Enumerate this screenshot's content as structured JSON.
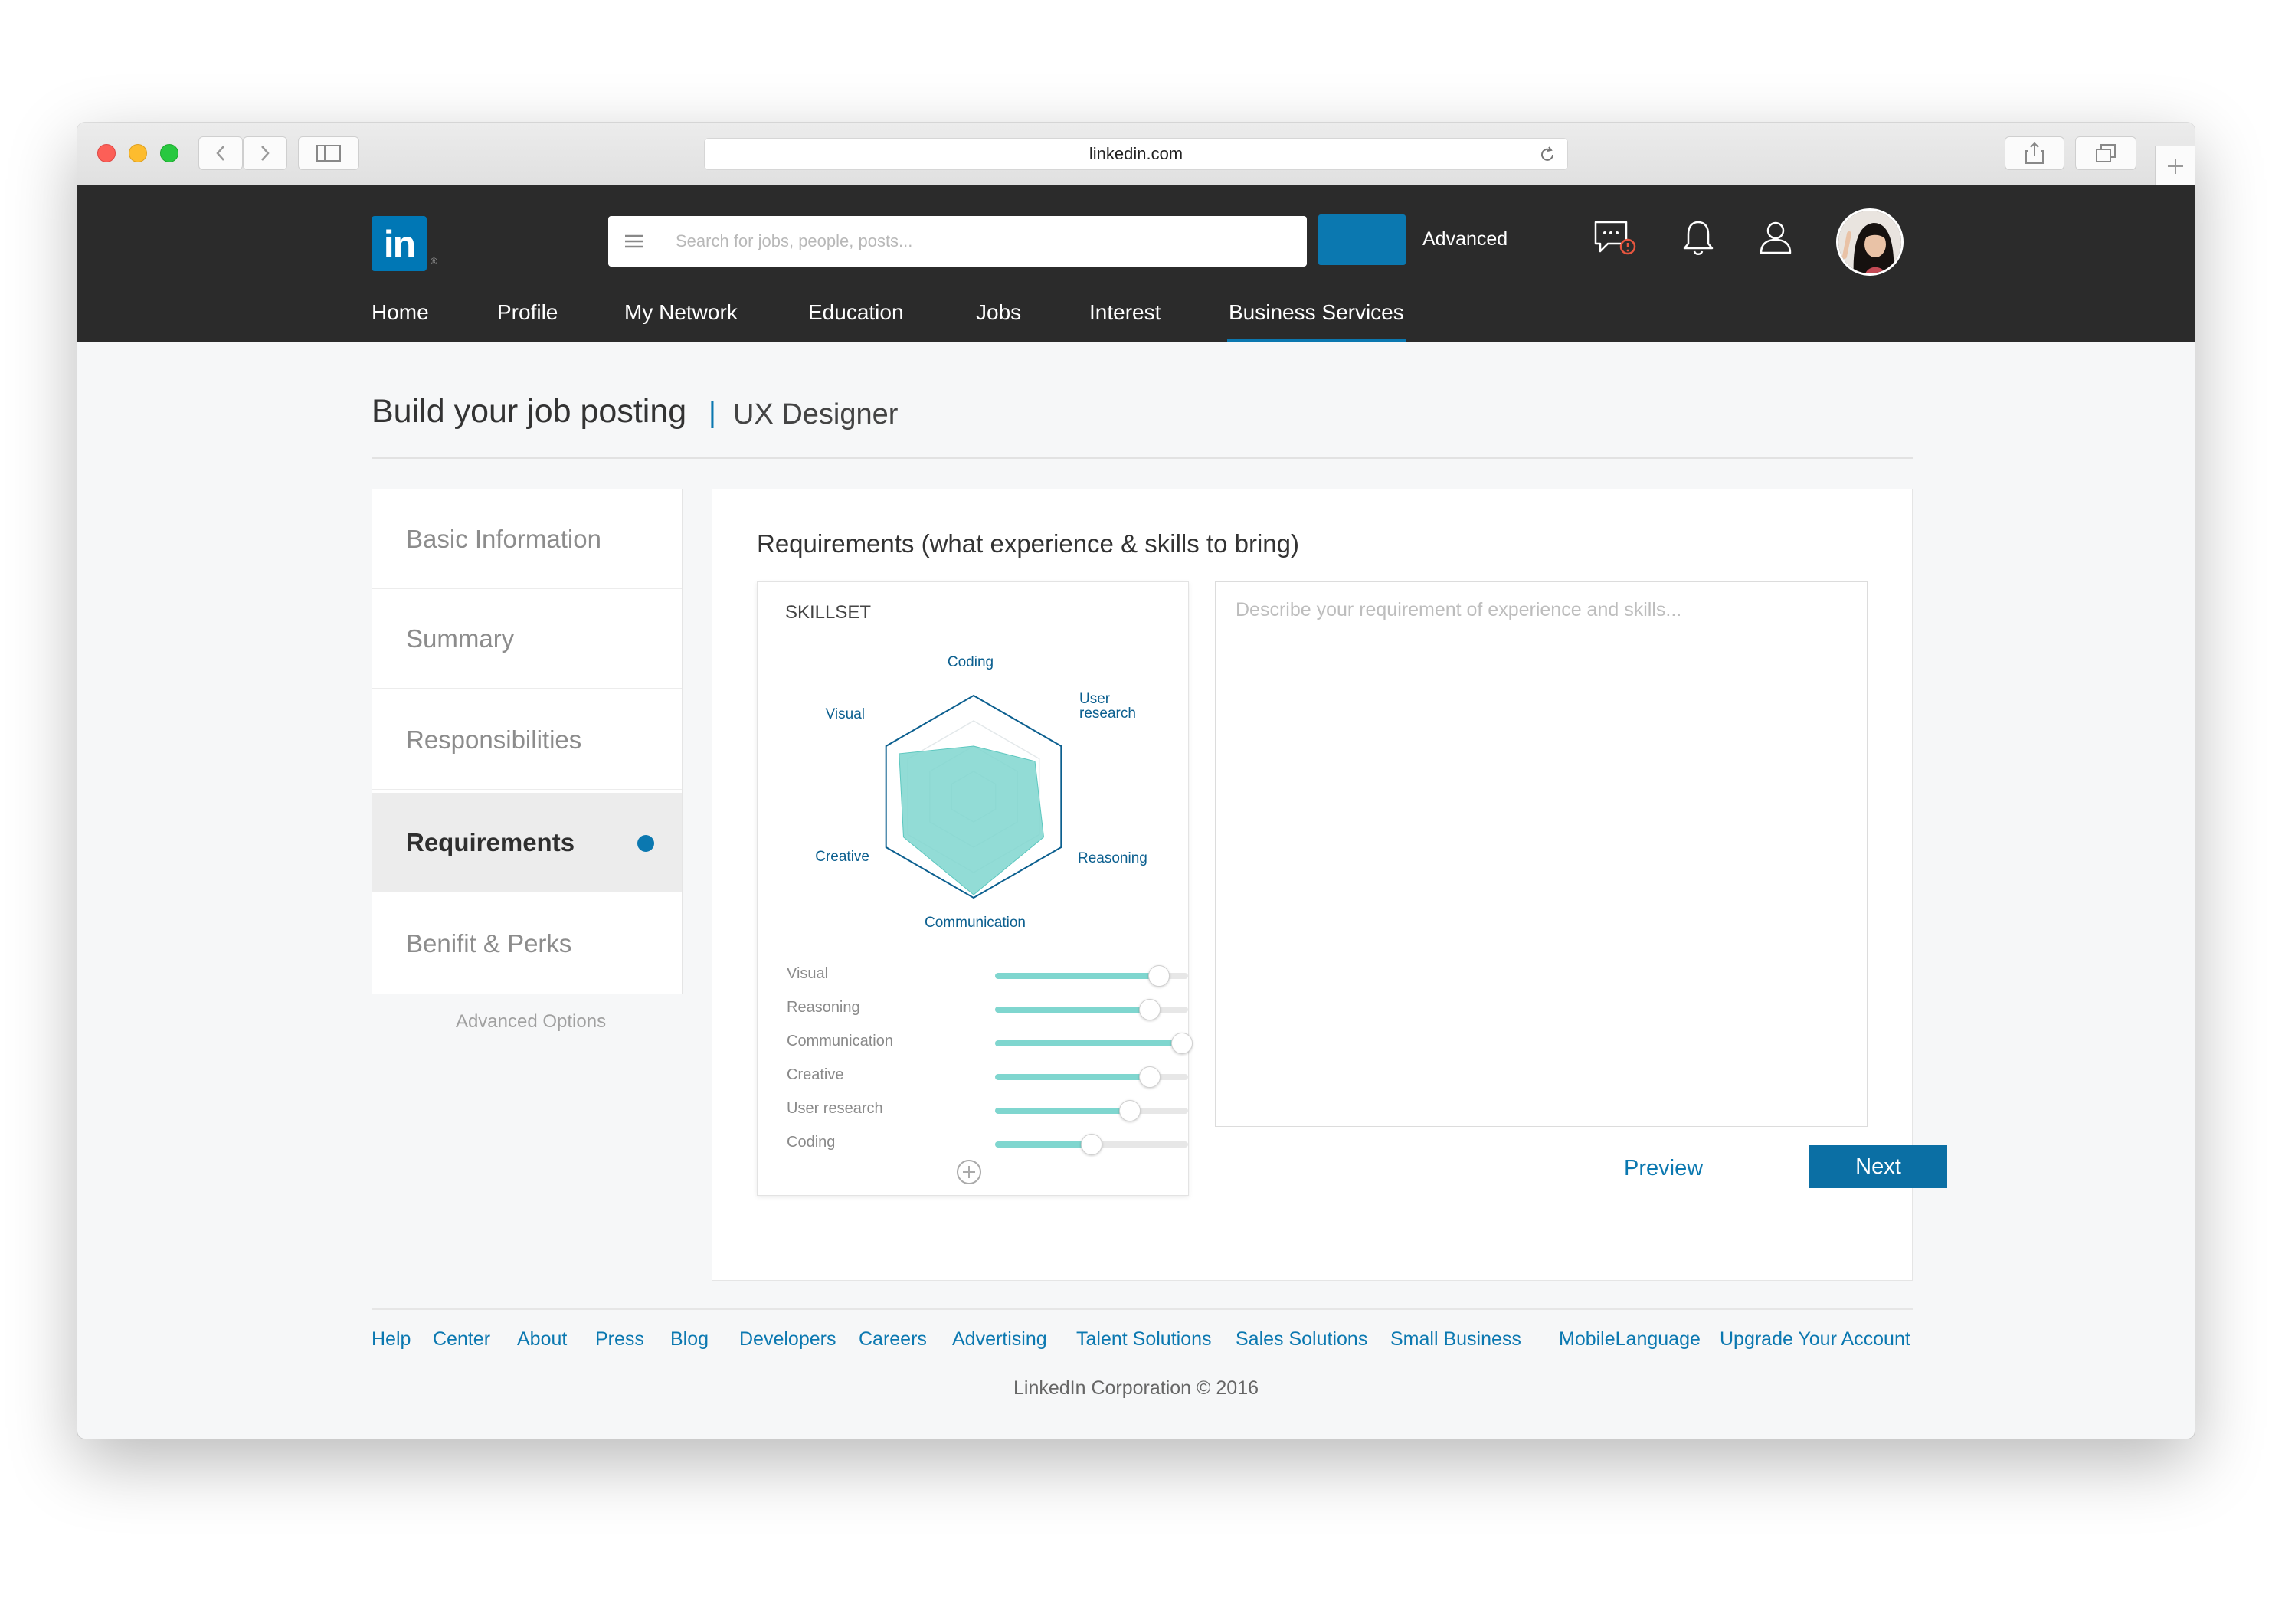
{
  "browser": {
    "url": "linkedin.com"
  },
  "header": {
    "logo_text": "in",
    "logo_reg": "®",
    "search_placeholder": "Search for jobs, people, posts...",
    "advanced_label": "Advanced",
    "brand_color": "#0077b5",
    "nav": [
      {
        "label": "Home"
      },
      {
        "label": "Profile"
      },
      {
        "label": "My Network"
      },
      {
        "label": "Education"
      },
      {
        "label": "Jobs"
      },
      {
        "label": "Interest"
      },
      {
        "label": "Business Services",
        "active": true
      }
    ],
    "icons": [
      "menu-icon",
      "messages-icon",
      "bell-icon",
      "user-icon",
      "avatar"
    ]
  },
  "page": {
    "title": "Build your job posting",
    "separator": "|",
    "subtitle": "UX Designer"
  },
  "steps": {
    "items": [
      {
        "label": "Basic Information"
      },
      {
        "label": "Summary"
      },
      {
        "label": "Responsibilities"
      },
      {
        "label": "Requirements",
        "active": true
      },
      {
        "label": "Benifit & Perks"
      }
    ],
    "advanced_options": "Advanced Options"
  },
  "requirements": {
    "heading": "Requirements (what experience & skills to bring)",
    "skillset_caption": "SKILLSET",
    "radar_labels": {
      "coding": "Coding",
      "user_research_1": "User",
      "user_research_2": "research",
      "reasoning": "Reasoning",
      "communication": "Communication",
      "creative": "Creative",
      "visual": "Visual"
    },
    "skills": [
      {
        "label": "Visual",
        "value": 0.85
      },
      {
        "label": "Reasoning",
        "value": 0.8
      },
      {
        "label": "Communication",
        "value": 0.97
      },
      {
        "label": "Creative",
        "value": 0.8
      },
      {
        "label": "User research",
        "value": 0.7
      },
      {
        "label": "Coding",
        "value": 0.5
      }
    ],
    "description_placeholder": "Describe your requirement of experience and skills...",
    "preview_label": "Preview",
    "next_label": "Next",
    "accent_color": "#7fd6cf"
  },
  "footer": {
    "links": [
      {
        "label": "Help"
      },
      {
        "label": "Center"
      },
      {
        "label": "About"
      },
      {
        "label": "Press"
      },
      {
        "label": "Blog"
      },
      {
        "label": "Developers"
      },
      {
        "label": "Careers"
      },
      {
        "label": "Advertising"
      },
      {
        "label": "Talent Solutions"
      },
      {
        "label": "Sales Solutions"
      },
      {
        "label": "Small Business"
      },
      {
        "label": "MobileLanguage"
      },
      {
        "label": "Upgrade Your Account"
      }
    ],
    "copyright": "LinkedIn Corporation © 2016"
  }
}
